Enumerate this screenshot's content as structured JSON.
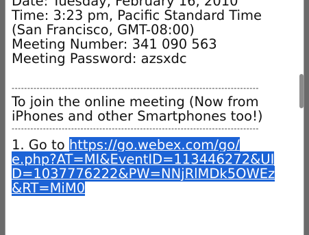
{
  "email": {
    "lines_top": [
      "Date: Tuesday, February 16, 2010",
      "Time: 3:23 pm, Pacific Standard Time",
      "(San Francisco, GMT-08:00)",
      "Meeting Number: 341 090 563",
      "Meeting Password: azsxdc"
    ],
    "separator": "-------------------------------------------------------------------------------",
    "join_intro": [
      "To join the online meeting (Now from",
      "iPhones and other Smartphones too!)"
    ],
    "step_prefix": "1. Go to ",
    "link_lines": [
      "https://go.webex.com/go/",
      "e.php?AT=MI&EventID=113446272&UI",
      "D=1037776222&PW=NNjRlMDk5OWEz",
      "&RT=MiM0"
    ]
  }
}
